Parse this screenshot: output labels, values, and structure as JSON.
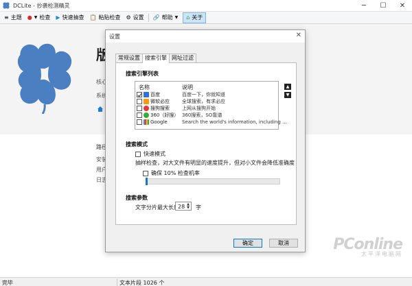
{
  "window": {
    "title": "DCLite - 抄袭检测精灵"
  },
  "toolbar": {
    "items": [
      {
        "label": "主题"
      },
      {
        "label": "检查"
      },
      {
        "label": "快速抽查"
      },
      {
        "label": "粘贴检查"
      },
      {
        "label": "设置"
      },
      {
        "label": "帮助"
      },
      {
        "label": "关于"
      }
    ]
  },
  "main": {
    "hero_title": "版",
    "hero_lines": [
      "核心",
      "系统"
    ],
    "section_title": "路径",
    "section_lines": [
      "安装",
      "用户",
      "日志"
    ]
  },
  "statusbar": {
    "left": "完毕",
    "right": "文本片段 1026 个"
  },
  "dialog": {
    "title": "设置",
    "tabs": [
      "常规设置",
      "搜索引擎",
      "网址过滤"
    ],
    "engine_list": {
      "heading": "搜索引擎列表",
      "col_name": "名称",
      "col_desc": "说明",
      "rows": [
        {
          "name": "百度",
          "desc": "百度一下，你就知道",
          "checked": true,
          "color": "#2f6fd6"
        },
        {
          "name": "微软必应",
          "desc": "全球搜索，有求必应",
          "checked": false,
          "color": "#f39c12"
        },
        {
          "name": "搜狗搜索",
          "desc": "上网从搜狗开始",
          "checked": false,
          "color": "#e53935"
        },
        {
          "name": "360（好搜）",
          "desc": "360搜索，SO靠谱",
          "checked": false,
          "color": "#36a936"
        },
        {
          "name": "Google",
          "desc": "Search the world's information, including ...",
          "checked": false,
          "color": "#4285f4"
        }
      ]
    },
    "mode": {
      "heading": "搜索模式",
      "fast_label": "快速模式",
      "note": "抽样检查，对大文件有明显的速度提升，但对小文件会降低准确度",
      "ensure_label": "确保 10% 检查机率",
      "ensure_value": 0.1
    },
    "params": {
      "heading": "搜索参数",
      "label": "文字分片最大长度",
      "value": "28",
      "unit": "字"
    },
    "ok_label": "确定",
    "cancel_label": "取消"
  },
  "watermark": {
    "main": "PConline",
    "sub": "太平洋电脑网"
  }
}
